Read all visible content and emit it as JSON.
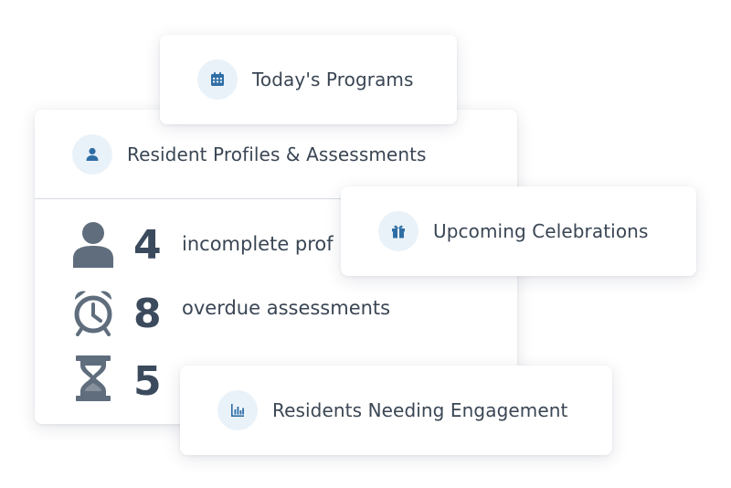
{
  "programs": {
    "title": "Today's Programs",
    "icon": "calendar-icon"
  },
  "profiles": {
    "title": "Resident Profiles & Assessments",
    "icon": "person-icon",
    "stats": [
      {
        "icon": "person-silhouette-icon",
        "value": "4",
        "label": "incomplete prof"
      },
      {
        "icon": "alarm-clock-icon",
        "value": "8",
        "label": "overdue assessments"
      },
      {
        "icon": "hourglass-icon",
        "value": "5",
        "label": ""
      }
    ]
  },
  "celebrations": {
    "title": "Upcoming Celebrations",
    "icon": "gift-icon"
  },
  "engagement": {
    "title": "Residents Needing Engagement",
    "icon": "bar-chart-icon"
  },
  "colors": {
    "accent": "#2f6ea5",
    "icon_bg": "#eaf2f9",
    "text": "#3a4654",
    "stat_icon": "#5f6d7d"
  }
}
